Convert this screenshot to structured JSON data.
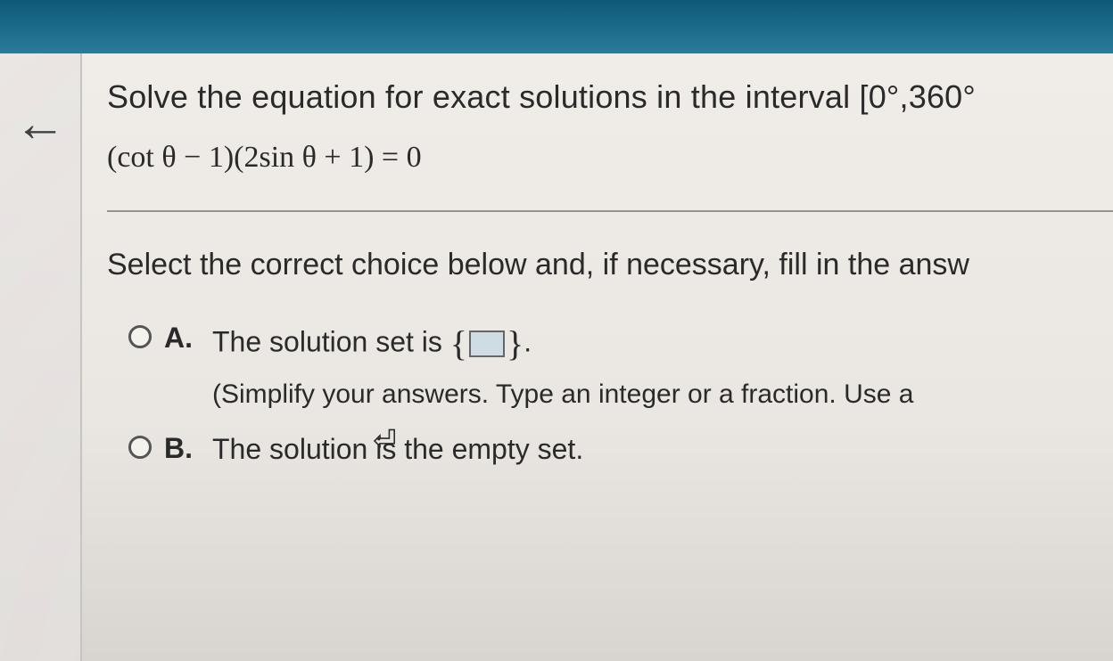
{
  "question": {
    "line1": "Solve the equation for exact solutions in the interval [0°,360°",
    "equation": "(cot θ − 1)(2sin θ + 1) = 0"
  },
  "prompt": "Select the correct choice below and, if necessary, fill in the answ",
  "choices": {
    "a": {
      "letter": "A.",
      "text_before": "The solution set is ",
      "text_after": ".",
      "hint": "(Simplify your answers. Type an integer or a fraction. Use a"
    },
    "b": {
      "letter": "B.",
      "text": "The solution is the empty set."
    }
  }
}
